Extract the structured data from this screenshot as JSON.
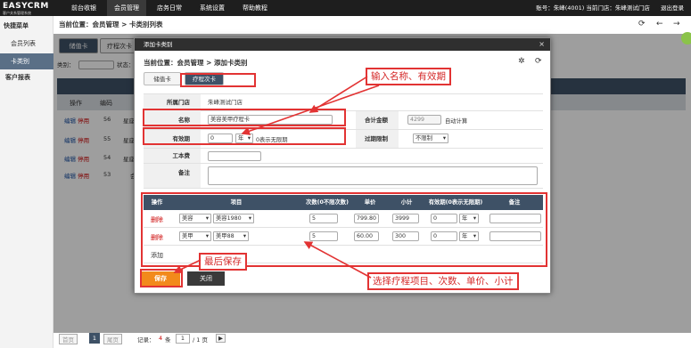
{
  "topbar": {
    "logo_main": "EASYCRM",
    "logo_sub": "客户关系管理系统",
    "nav": [
      "前台收银",
      "会员管理",
      "店务日常",
      "系统设置",
      "帮助教程"
    ],
    "user_info": "账号：朱峰(4001)  当前门店：朱峰测试门店",
    "logout": "退出登录"
  },
  "sidebar": {
    "heading": "快捷菜单",
    "items": [
      "会员列表",
      "卡类别",
      "客户报表"
    ]
  },
  "page": {
    "breadcrumb": "当前位置：会员管理 > 卡类别列表",
    "tabs": [
      "储值卡",
      "疗程次卡"
    ],
    "filter_label1": "类别：",
    "filter_label2": "状态："
  },
  "background_table": {
    "header": [
      "操作",
      "编码"
    ],
    "rows": [
      {
        "edit": "编辑",
        "disable": "停用",
        "code": "56",
        "name": "星座"
      },
      {
        "edit": "编辑",
        "disable": "停用",
        "code": "55",
        "name": "星座"
      },
      {
        "edit": "编辑",
        "disable": "停用",
        "code": "54",
        "name": "星座"
      },
      {
        "edit": "编辑",
        "disable": "停用",
        "code": "53",
        "name": "会"
      }
    ]
  },
  "pager": {
    "first": "首页",
    "page": "1",
    "last": "尾页",
    "record_prefix": "记录：",
    "record_count": "4",
    "record_unit": "条",
    "page_input": "1",
    "page_total": "/ 1 页"
  },
  "modal": {
    "title": "添加卡类别",
    "close": "×",
    "breadcrumb": "当前位置：会员管理 > 添加卡类别",
    "tabs": [
      "储值卡",
      "疗程次卡"
    ],
    "store_label": "所属门店",
    "store_value": "朱峰测试门店",
    "name_label": "名称",
    "name_value": "美容美甲疗程卡",
    "total_label": "合计金额",
    "total_value": "4299",
    "auto_calc": "自动计算",
    "validity_label": "有效期",
    "validity_value": "0",
    "validity_unit": "年",
    "validity_hint": "0表示无限期",
    "limit_label": "过期限制",
    "limit_value": "不限制",
    "cost_label": "工本费",
    "cost_value": "",
    "remark_label": "备注",
    "remark_value": "",
    "table_header": [
      "操作",
      "项目",
      "次数(0不限次数)",
      "单价",
      "小计",
      "有效期(0表示无限期)",
      "备注"
    ],
    "rows": [
      {
        "op": "删除",
        "category": "美容",
        "item": "美容1980",
        "times": "5",
        "price": "799.80",
        "subtotal": "3999",
        "validity": "0",
        "unit": "年",
        "remark": ""
      },
      {
        "op": "删除",
        "category": "美甲",
        "item": "美甲88",
        "times": "5",
        "price": "60.00",
        "subtotal": "300",
        "validity": "0",
        "unit": "年",
        "remark": ""
      }
    ],
    "add_label": "添加",
    "save_button": "保存",
    "close_button": "关闭"
  },
  "annotations": {
    "note1": "输入名称、有效期",
    "note2": "最后保存",
    "note3": "选择疗程项目、次数、单价、小计"
  },
  "colors": {
    "topbar": "#1e1e1e",
    "accent_active": "#3e5166",
    "save_orange": "#f28a1b",
    "annotation_red": "#e23333"
  }
}
